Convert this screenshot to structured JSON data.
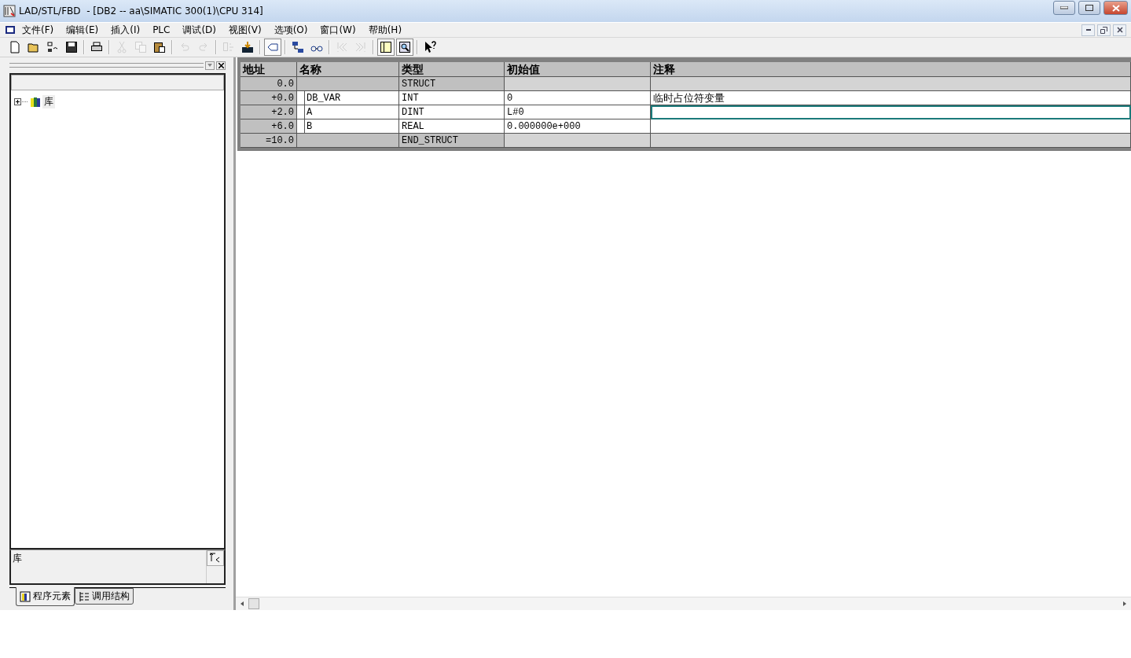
{
  "window": {
    "title": "LAD/STL/FBD  - [DB2 -- aa\\SIMATIC 300(1)\\CPU 314]"
  },
  "menu": [
    "文件(F)",
    "编辑(E)",
    "插入(I)",
    "PLC",
    "调试(D)",
    "视图(V)",
    "选项(O)",
    "窗口(W)",
    "帮助(H)"
  ],
  "toolbar": [
    {
      "kind": "new",
      "disabled": false
    },
    {
      "kind": "open",
      "disabled": false
    },
    {
      "kind": "network",
      "disabled": false
    },
    {
      "kind": "save",
      "disabled": false
    },
    {
      "kind": "sep"
    },
    {
      "kind": "print",
      "disabled": false
    },
    {
      "kind": "sep"
    },
    {
      "kind": "cut",
      "disabled": true
    },
    {
      "kind": "copy",
      "disabled": true
    },
    {
      "kind": "paste",
      "disabled": false
    },
    {
      "kind": "sep"
    },
    {
      "kind": "undo",
      "disabled": true
    },
    {
      "kind": "redo",
      "disabled": true
    },
    {
      "kind": "sep"
    },
    {
      "kind": "monitor",
      "disabled": true
    },
    {
      "kind": "download",
      "disabled": false
    },
    {
      "kind": "sep"
    },
    {
      "kind": "tag",
      "disabled": false,
      "selected": true
    },
    {
      "kind": "sep"
    },
    {
      "kind": "node",
      "disabled": false
    },
    {
      "kind": "glasses",
      "disabled": false
    },
    {
      "kind": "sep"
    },
    {
      "kind": "prev",
      "disabled": true
    },
    {
      "kind": "next",
      "disabled": true
    },
    {
      "kind": "sep"
    },
    {
      "kind": "panel",
      "disabled": false,
      "selected": true
    },
    {
      "kind": "zoom",
      "disabled": false,
      "selected": true
    },
    {
      "kind": "sep"
    },
    {
      "kind": "help",
      "disabled": false
    }
  ],
  "tree": [
    {
      "label": "库",
      "expanded": false
    }
  ],
  "info": {
    "text": "库"
  },
  "tabs": [
    {
      "label": "程序元素",
      "selected": true
    },
    {
      "label": "调用结构",
      "selected": false
    }
  ],
  "table": {
    "columns": [
      "地址",
      "名称",
      "类型",
      "初始值",
      "注释"
    ],
    "rows": [
      {
        "kind": "struct",
        "address": "0.0",
        "type": "STRUCT",
        "selected": false
      },
      {
        "kind": "var",
        "address": "+0.0",
        "name": "DB_VAR",
        "type": "INT",
        "initial": "0",
        "comment": "临时占位符变量",
        "selected": false
      },
      {
        "kind": "var",
        "address": "+2.0",
        "name": "A",
        "type": "DINT",
        "initial": "L#0",
        "selected": true
      },
      {
        "kind": "var",
        "address": "+6.0",
        "name": "B",
        "type": "REAL",
        "initial": "0.000000e+000",
        "selected": false
      },
      {
        "kind": "struct",
        "address": "=10.0",
        "type": "END_STRUCT",
        "selected": false
      }
    ]
  }
}
